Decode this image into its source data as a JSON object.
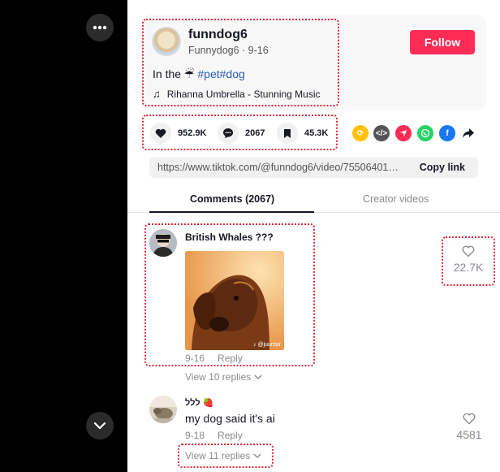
{
  "author": {
    "name": "funndog6",
    "sub": "Funnydog6 · 9-16",
    "caption_prefix": "In the",
    "caption_emoji": "☔",
    "caption_tags": "#pet#dog",
    "music": "Rihanna Umbrella - Stunning Music",
    "follow_label": "Follow"
  },
  "stats": {
    "likes": "952.9K",
    "comments": "2067",
    "saves": "45.3K"
  },
  "share": {
    "url": "https://www.tiktok.com/@funndog6/video/755064019...",
    "copy_label": "Copy link"
  },
  "tabs": {
    "comments": "Comments (2067)",
    "creator": "Creator videos"
  },
  "comments": [
    {
      "user": "British Whales ???",
      "date": "9-16",
      "reply_label": "Reply",
      "likes": "22.7K",
      "view_replies": "View 10 replies",
      "gif_credit": "♪ @juuntar"
    },
    {
      "user": "ללל 🍓",
      "text": "my dog said it's ai",
      "date": "9-18",
      "reply_label": "Reply",
      "likes": "4581",
      "view_replies": "View 11 replies"
    }
  ],
  "colors": {
    "accent": "#fe2c55",
    "hashtag": "#2b5db9",
    "highlight": "#e0283a"
  }
}
